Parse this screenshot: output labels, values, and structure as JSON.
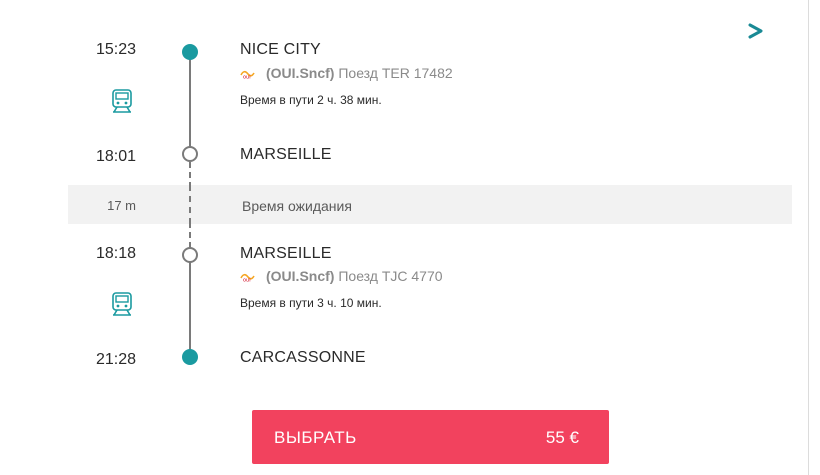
{
  "colors": {
    "accent_teal": "#1a9aa0",
    "button_pink": "#f2425e",
    "timeline_gray": "#7a7a7a",
    "wait_band": "#f2f2f2"
  },
  "icons": {
    "expand": "chevron-right-icon",
    "train": "train-icon",
    "carrier": "oui-sncf-logo"
  },
  "legs": [
    {
      "depart_time": "15:23",
      "depart_station": "NICE CITY",
      "carrier": "(OUI.Sncf)",
      "train": "Поезд TER 17482",
      "duration": "Время в пути 2 ч. 38 мин.",
      "arrive_time": "18:01",
      "arrive_station": "MARSEILLE"
    },
    {
      "depart_time": "18:18",
      "depart_station": "MARSEILLE",
      "carrier": "(OUI.Sncf)",
      "train": "Поезд TJC 4770",
      "duration": "Время в пути 3 ч. 10 мин.",
      "arrive_time": "21:28",
      "arrive_station": "CARCASSONNE"
    }
  ],
  "transfer": {
    "wait_time": "17 m",
    "label": "Время ожидания"
  },
  "select_button": {
    "label": "ВЫБРАТЬ",
    "price": "55 €"
  }
}
